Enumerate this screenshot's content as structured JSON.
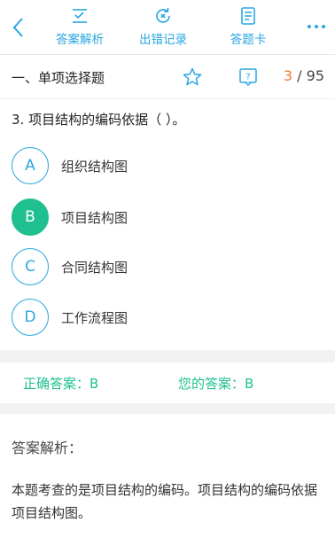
{
  "toolbar": {
    "analysis_label": "答案解析",
    "errors_label": "出错记录",
    "card_label": "答题卡",
    "accent_color": "#2aa6e0"
  },
  "section": {
    "title": "一、单项选择题",
    "current": "3",
    "separator": " / ",
    "total": "95"
  },
  "question": {
    "text": "3. 项目结构的编码依据（     ）。"
  },
  "options": [
    {
      "letter": "A",
      "text": "组织结构图",
      "selected": false
    },
    {
      "letter": "B",
      "text": "项目结构图",
      "selected": true
    },
    {
      "letter": "C",
      "text": "合同结构图",
      "selected": false
    },
    {
      "letter": "D",
      "text": "工作流程图",
      "selected": false
    }
  ],
  "answers": {
    "correct": "正确答案：B",
    "yours": "您的答案：B",
    "color": "#1fbf8f"
  },
  "explanation": {
    "title": "答案解析：",
    "text": "本题考查的是项目结构的编码。项目结构的编码依据项目结构图。"
  }
}
